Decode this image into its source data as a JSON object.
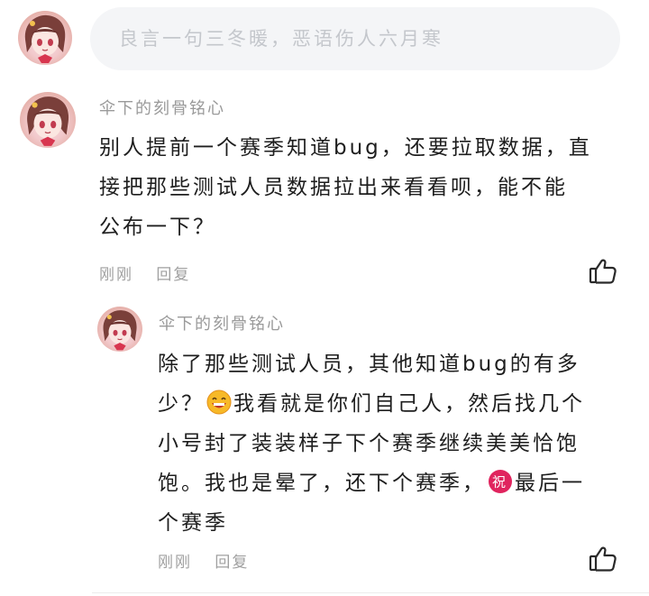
{
  "composer": {
    "placeholder": "良言一句三冬暖，恶语伤人六月寒"
  },
  "comments": [
    {
      "username": "伞下的刻骨铭心",
      "lines": [
        "别人提前一个赛季知道bug，还要拉取数据，直",
        "接把那些测试人员数据拉出来看看呗，能不能",
        "公布一下？"
      ],
      "time": "刚刚",
      "reply_label": "回复",
      "avatar_icon": "anime-girl-avatar",
      "like_icon": "thumbs-up-icon"
    },
    {
      "username": "伞下的刻骨铭心",
      "lines": [
        {
          "parts": [
            "除了那些测试人员，其他知道bug的有多"
          ]
        },
        {
          "parts": [
            "少？",
            "",
            "我看就是你们自己人，然后找几个"
          ],
          "emoji": "grinning-face-emoji"
        },
        {
          "parts": [
            "小号封了装装样子下个赛季继续美美恰饱"
          ]
        },
        {
          "parts": [
            "饱。我也是晕了，还下个赛季，",
            "",
            "最后一"
          ],
          "emoji": "congratulations-emoji"
        },
        {
          "parts": [
            "个赛季"
          ]
        }
      ],
      "time": "刚刚",
      "reply_label": "回复",
      "avatar_icon": "anime-girl-avatar",
      "like_icon": "thumbs-up-icon"
    }
  ],
  "colors": {
    "text": "#1e1e1e",
    "meta": "#a0a0a0",
    "username": "#9a9a9a",
    "input_bg": "#f4f5f7",
    "placeholder": "#c4c7cc"
  }
}
